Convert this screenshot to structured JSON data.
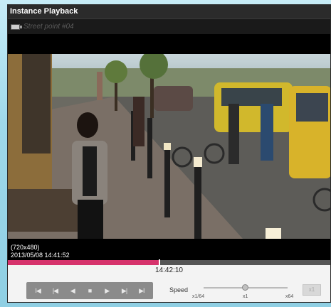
{
  "window": {
    "title": "Instance Playback"
  },
  "camera": {
    "name": "Street point #04",
    "icon": "camera-icon"
  },
  "video": {
    "resolution": "(720x480)",
    "timestamp": "2013/05/08 14:41:52"
  },
  "timeline": {
    "progress_fraction": 0.47,
    "current_time": "14:42:10",
    "fill_color": "#d6336c"
  },
  "controls": {
    "buttons": [
      {
        "name": "go-to-start-button",
        "icon": "skip-start-icon",
        "glyph": "I◀"
      },
      {
        "name": "previous-frame-button",
        "icon": "step-back-icon",
        "glyph": "|◀"
      },
      {
        "name": "reverse-play-button",
        "icon": "play-reverse-icon",
        "glyph": "◀"
      },
      {
        "name": "stop-button",
        "icon": "stop-icon",
        "glyph": "■"
      },
      {
        "name": "play-button",
        "icon": "play-icon",
        "glyph": "▶"
      },
      {
        "name": "next-frame-button",
        "icon": "step-forward-icon",
        "glyph": "▶|"
      },
      {
        "name": "go-to-end-button",
        "icon": "skip-end-icon",
        "glyph": "▶I"
      }
    ]
  },
  "speed": {
    "label": "Speed",
    "min_label": "x1/64",
    "mid_label": "x1",
    "max_label": "x64",
    "level_fraction": 0.5,
    "button_label": "x1"
  }
}
